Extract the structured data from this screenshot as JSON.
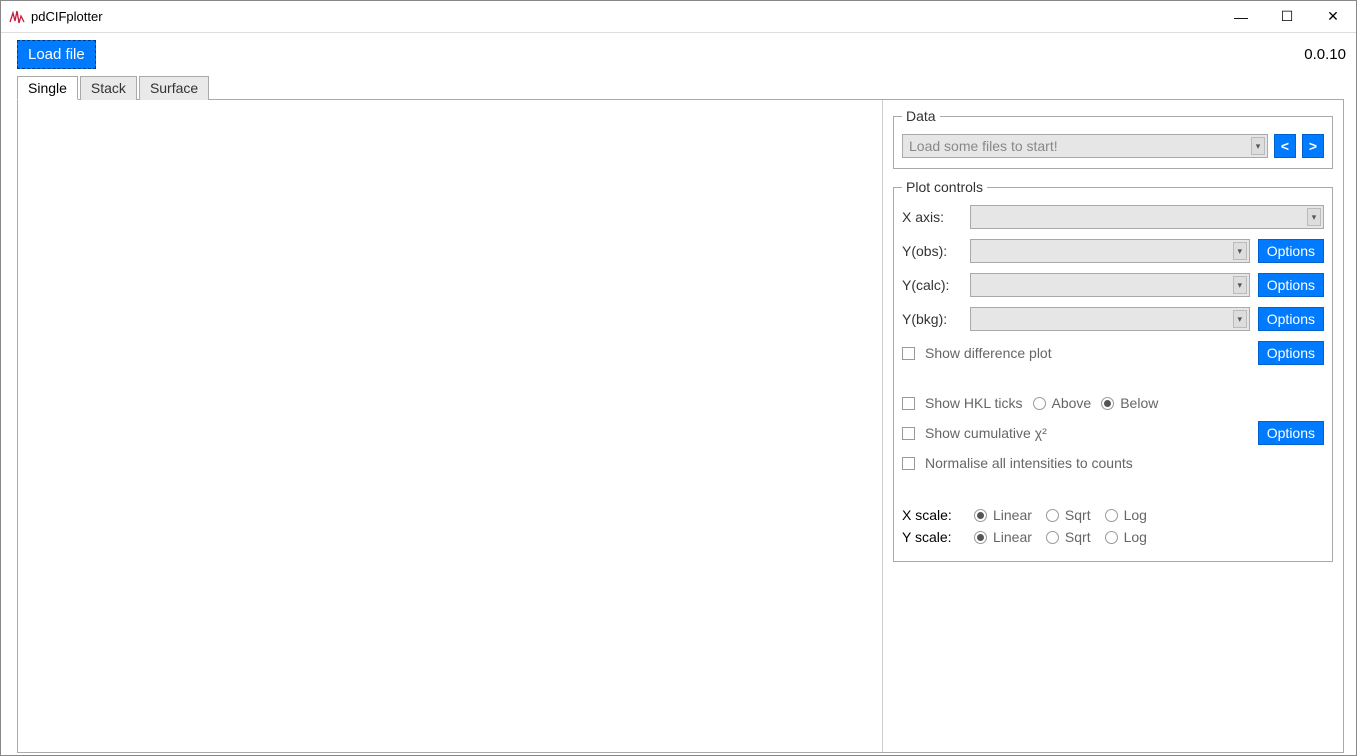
{
  "window": {
    "title": "pdCIFplotter",
    "minimize": "—",
    "maximize": "☐",
    "close": "✕"
  },
  "toolbar": {
    "load_file": "Load file",
    "version": "0.0.10"
  },
  "tabs": {
    "single": "Single",
    "stack": "Stack",
    "surface": "Surface"
  },
  "data_group": {
    "legend": "Data",
    "placeholder": "Load some files to start!",
    "prev": "<",
    "next": ">"
  },
  "plot_controls": {
    "legend": "Plot controls",
    "x_axis": "X axis:",
    "y_obs": "Y(obs):",
    "y_calc": "Y(calc):",
    "y_bkg": "Y(bkg):",
    "options": "Options",
    "show_diff": "Show difference plot",
    "show_hkl": "Show HKL ticks",
    "above": "Above",
    "below": "Below",
    "show_cum_chi2": "Show cumulative χ²",
    "normalise": "Normalise all intensities to counts",
    "x_scale": "X scale:",
    "y_scale": "Y scale:",
    "linear": "Linear",
    "sqrt": "Sqrt",
    "log": "Log"
  }
}
